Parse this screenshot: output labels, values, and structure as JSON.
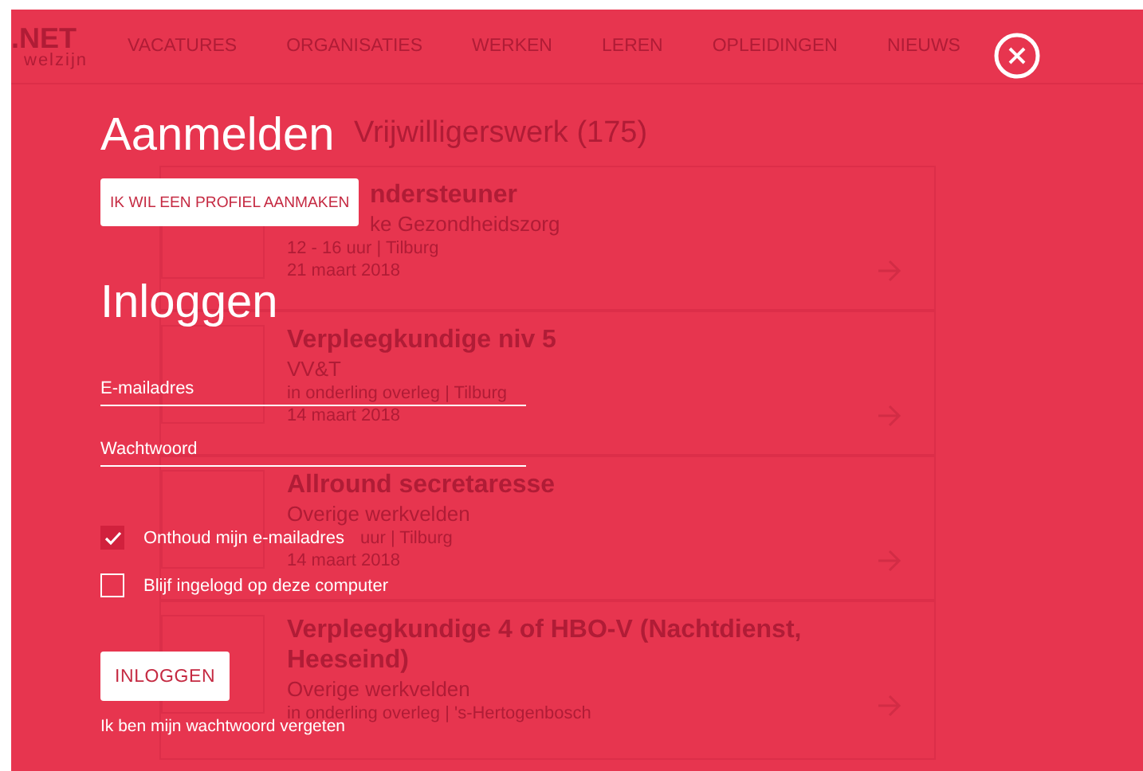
{
  "background_page": {
    "logo": {
      "title": ".NET",
      "subtitle": "welzijn"
    },
    "nav": [
      "VACATURES",
      "ORGANISATIES",
      "WERKEN",
      "LEREN",
      "OPLEIDINGEN",
      "NIEUWS"
    ],
    "heading": "Vrijwilligerswerk (175)",
    "jobs": [
      {
        "kind": "partly_covered",
        "title": "ndersteuner",
        "organisation": "ke Gezondheidszorg",
        "details": "12 - 16 uur | Tilburg",
        "date": "21 maart 2018"
      },
      {
        "kind": "full",
        "title": "Verpleegkundige niv 5",
        "organisation": "VV&T",
        "details": "in onderling overleg | Tilburg",
        "date": "14 maart 2018"
      },
      {
        "kind": "details_covered",
        "title": "Allround secretaresse",
        "organisation": "Overige werkvelden",
        "details": "uur | Tilburg",
        "date": "14 maart 2018"
      },
      {
        "kind": "full",
        "title": "Verpleegkundige 4 of HBO-V (Nachtdienst, Heeseind)",
        "organisation": "Overige werkvelden",
        "details": "in onderling overleg | 's-Hertogenbosch"
      }
    ]
  },
  "modal": {
    "register_title": "Aanmelden",
    "register_button": "IK WIL EEN PROFIEL AANMAKEN",
    "login_title": "Inloggen",
    "fields": [
      {
        "placeholder": "E-mailadres"
      },
      {
        "placeholder": "Wachtwoord"
      }
    ],
    "checkboxes": [
      {
        "label": "Onthoud mijn e-mailadres",
        "checked": true
      },
      {
        "label": "Blijf ingelogd op deze computer",
        "checked": false
      }
    ],
    "login_button": "INLOGGEN",
    "forgot_link": "Ik ben mijn wachtwoord vergeten"
  }
}
